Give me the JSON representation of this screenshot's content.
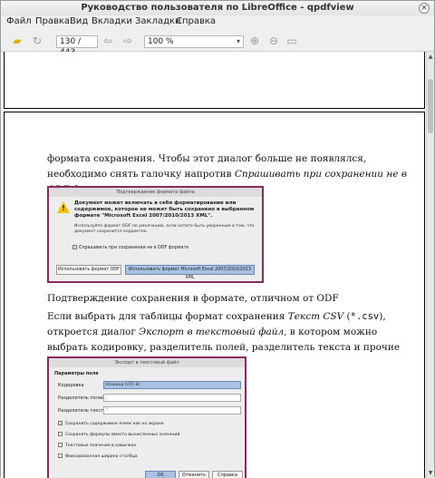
{
  "window": {
    "title": "Руководство пользователя по LibreOffice - qpdfview"
  },
  "menu": [
    "Файл",
    "Правка",
    "Вид",
    "Вкладки",
    "Закладки",
    "Справка"
  ],
  "toolbar": {
    "page": "130 / 443",
    "zoom": "100 %"
  },
  "document": {
    "para1_plain": "формата сохранения. Чтобы этот диалог больше не появлялся, необходимо снять галочку напротив ",
    "para1_italic": "Спрашивать при сохранении не в ODF формат",
    "para1_end": ".",
    "caption1": "Подтверждение сохранения в формате, отличном от ODF",
    "para2_a": "Если выбрать для таблицы формат сохранения ",
    "para2_italic1": "Текст CSV",
    "para2_b": " (",
    "para2_mono": "*.csv",
    "para2_c": "), откроется диалог ",
    "para2_italic2": "Экспорт в текстовый файл",
    "para2_d": ", в котором можно выбрать кодировку, разделитель полей, разделитель текста и прочие настройки."
  },
  "dialog1": {
    "title": "Подтверждение формата файла",
    "message": "Документ может включать в себя форматирование или содержимое, которое не может быть сохранено в выбранном формате \"Microsoft Excel 2007/2010/2013 XML\".",
    "sub": "Используйте формат ODF по умолчанию, если хотите быть уверенным в том, что документ сохранится корректно.",
    "checkbox": "Спрашивать при сохранении не в ODF формате",
    "btn_odf": "Использовать формат ODF",
    "btn_xml": "Использовать формат Microsoft Excel 2007/2010/2013 XML"
  },
  "dialog2": {
    "title": "Экспорт в текстовый файл",
    "group": "Параметры поля",
    "encoding_label": "Кодировка",
    "encoding_value": "Юникод (UTF-8)",
    "field_sep_label": "Разделитель полей",
    "field_sep_value": ",",
    "text_sep_label": "Разделитель текста",
    "text_sep_value": "\"",
    "opt1": "Сохранить содержимое ячеек как на экране",
    "opt2": "Сохранять формулы вместо вычисленных значений",
    "opt3": "Текстовые значения в кавычках",
    "opt4": "Фиксированная ширина столбца",
    "btn_ok": "OK",
    "btn_cancel": "Отменить",
    "btn_help": "Справка"
  },
  "colors": {
    "frame": "#8a2b5f",
    "selection": "#a9c2e3"
  }
}
